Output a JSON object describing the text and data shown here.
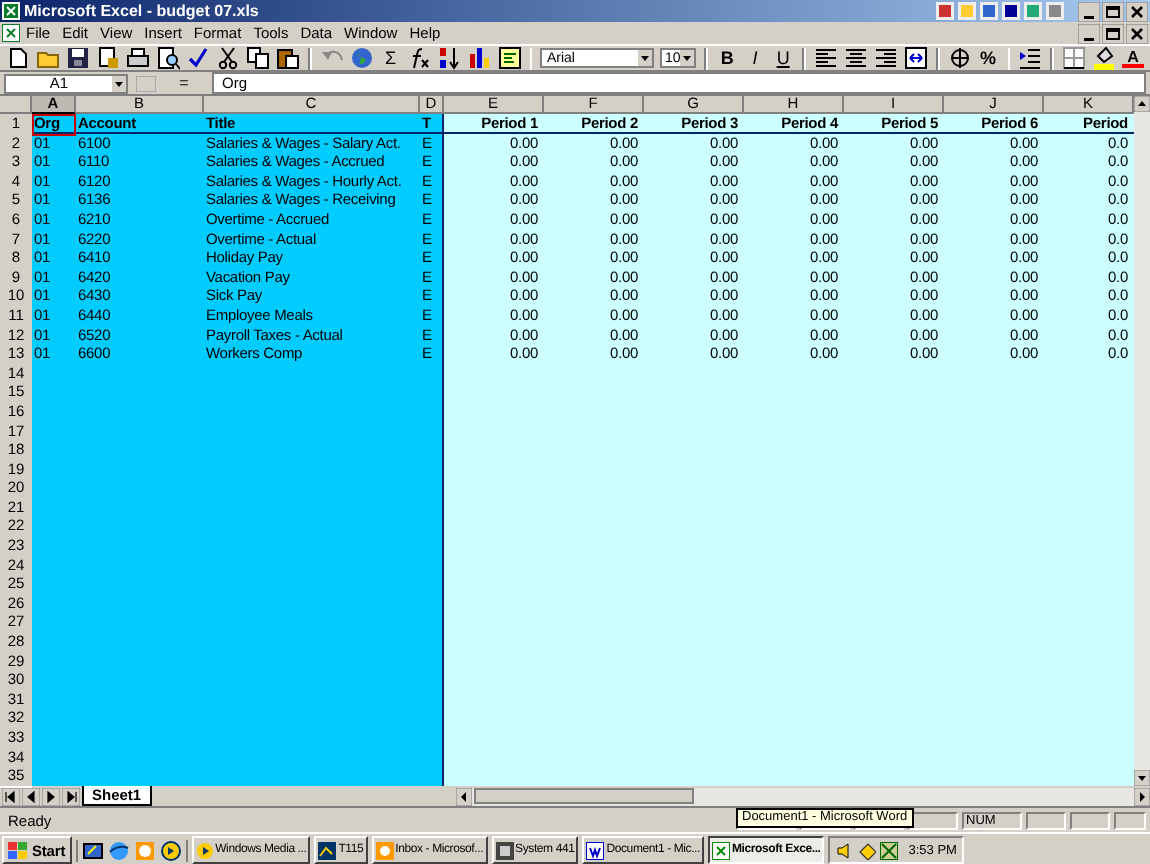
{
  "window": {
    "title": "Microsoft Excel - budget 07.xls"
  },
  "menu": [
    "File",
    "Edit",
    "View",
    "Insert",
    "Format",
    "Tools",
    "Data",
    "Window",
    "Help"
  ],
  "toolbar": {
    "sum": "Σ",
    "font": "Arial",
    "size": "10",
    "style_buttons": [
      "B",
      "I",
      "U"
    ],
    "percent": "%",
    "font_color_button": "A"
  },
  "formula_bar": {
    "name_box": "A1",
    "equals": "=",
    "value": "Org"
  },
  "grid": {
    "columns": [
      {
        "label": "A",
        "selected": true
      },
      {
        "label": "B",
        "selected": false
      },
      {
        "label": "C",
        "selected": false
      },
      {
        "label": "D",
        "selected": false
      },
      {
        "label": "E",
        "selected": false
      },
      {
        "label": "F",
        "selected": false
      },
      {
        "label": "G",
        "selected": false
      },
      {
        "label": "H",
        "selected": false
      },
      {
        "label": "I",
        "selected": false
      },
      {
        "label": "J",
        "selected": false
      },
      {
        "label": "K",
        "selected": false
      }
    ],
    "row_numbers": [
      "1",
      "2",
      "3",
      "4",
      "5",
      "6",
      "7",
      "8",
      "9",
      "10",
      "11",
      "12",
      "13",
      "14",
      "15",
      "16",
      "17",
      "18",
      "19",
      "20",
      "21",
      "22",
      "23",
      "24",
      "25",
      "26",
      "27",
      "28",
      "29",
      "30",
      "31",
      "32",
      "33",
      "34",
      "35"
    ],
    "rows": [
      [
        "Org",
        "Account",
        "Title",
        "T",
        "Period 1",
        "Period 2",
        "Period 3",
        "Period 4",
        "Period 5",
        "Period 6",
        "Period"
      ],
      [
        "01",
        "6100",
        "Salaries & Wages - Salary Act.",
        "E",
        "0.00",
        "0.00",
        "0.00",
        "0.00",
        "0.00",
        "0.00",
        "0.0"
      ],
      [
        "01",
        "6110",
        "Salaries & Wages - Accrued",
        "E",
        "0.00",
        "0.00",
        "0.00",
        "0.00",
        "0.00",
        "0.00",
        "0.0"
      ],
      [
        "01",
        "6120",
        "Salaries & Wages - Hourly Act.",
        "E",
        "0.00",
        "0.00",
        "0.00",
        "0.00",
        "0.00",
        "0.00",
        "0.0"
      ],
      [
        "01",
        "6136",
        "Salaries & Wages - Receiving",
        "E",
        "0.00",
        "0.00",
        "0.00",
        "0.00",
        "0.00",
        "0.00",
        "0.0"
      ],
      [
        "01",
        "6210",
        "Overtime - Accrued",
        "E",
        "0.00",
        "0.00",
        "0.00",
        "0.00",
        "0.00",
        "0.00",
        "0.0"
      ],
      [
        "01",
        "6220",
        "Overtime - Actual",
        "E",
        "0.00",
        "0.00",
        "0.00",
        "0.00",
        "0.00",
        "0.00",
        "0.0"
      ],
      [
        "01",
        "6410",
        "Holiday Pay",
        "E",
        "0.00",
        "0.00",
        "0.00",
        "0.00",
        "0.00",
        "0.00",
        "0.0"
      ],
      [
        "01",
        "6420",
        "Vacation Pay",
        "E",
        "0.00",
        "0.00",
        "0.00",
        "0.00",
        "0.00",
        "0.00",
        "0.0"
      ],
      [
        "01",
        "6430",
        "Sick Pay",
        "E",
        "0.00",
        "0.00",
        "0.00",
        "0.00",
        "0.00",
        "0.00",
        "0.0"
      ],
      [
        "01",
        "6440",
        "Employee Meals",
        "E",
        "0.00",
        "0.00",
        "0.00",
        "0.00",
        "0.00",
        "0.00",
        "0.0"
      ],
      [
        "01",
        "6520",
        "Payroll Taxes - Actual",
        "E",
        "0.00",
        "0.00",
        "0.00",
        "0.00",
        "0.00",
        "0.00",
        "0.0"
      ],
      [
        "01",
        "6600",
        "Workers Comp",
        "E",
        "0.00",
        "0.00",
        "0.00",
        "0.00",
        "0.00",
        "0.00",
        "0.0"
      ]
    ]
  },
  "sheet_tabs": [
    {
      "label": "Sheet1",
      "selected": true
    }
  ],
  "status_bar": {
    "text": "Ready",
    "indicators": [
      "NUM"
    ]
  },
  "tooltip": "Document1 - Microsoft Word",
  "taskbar": {
    "start": "Start",
    "tasks": [
      {
        "label": "Windows Media ...",
        "selected": false
      },
      {
        "label": "T115",
        "selected": false
      },
      {
        "label": "Inbox - Microsof...",
        "selected": false
      },
      {
        "label": "System 441",
        "selected": false
      },
      {
        "label": "Document1 - Mic...",
        "selected": false
      },
      {
        "label": "Microsoft Exce...",
        "selected": true
      }
    ],
    "clock": "3:53 PM"
  }
}
